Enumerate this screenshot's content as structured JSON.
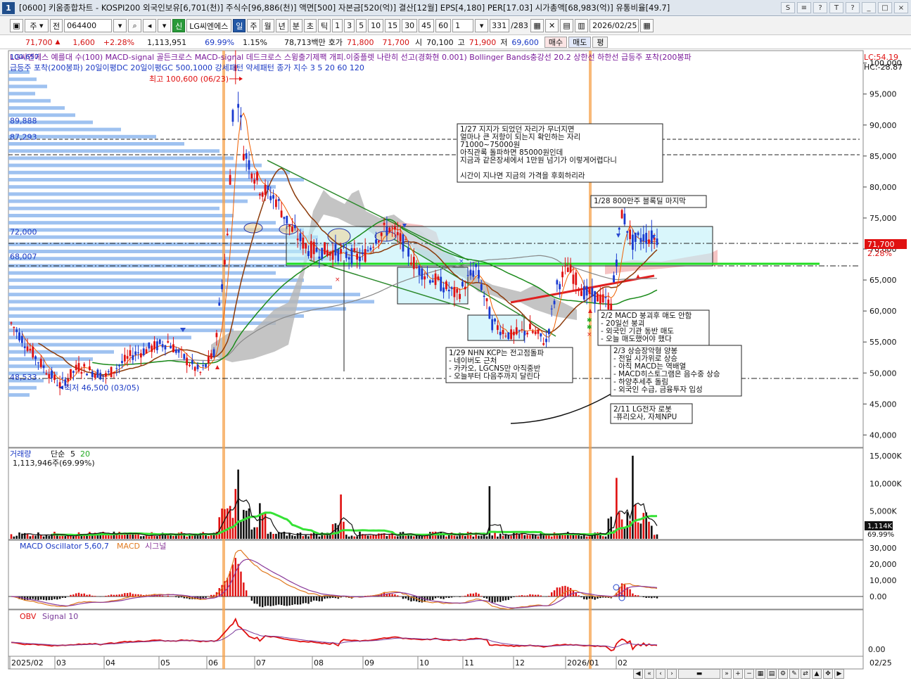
{
  "window": {
    "screen_no": "1",
    "title": "[0600] 키움종합차트 - KOSPI200 외국인보유[6,701(천)] 주식수[96,886(천)] 액면[500] 자본금[520(억)] 결산[12월] EPS[4,180] PER[17.03] 시가총액[68,983(억)] 유통비율[49.7]",
    "controls": [
      "S",
      "≡",
      "?",
      "T",
      "?",
      "_",
      "□",
      "×"
    ]
  },
  "toolbar": {
    "market_select": "주",
    "prev_label": "전",
    "code": "064400",
    "stock_name": "LG씨엔에스",
    "badge_sin": "신",
    "periods": [
      "일",
      "주",
      "월",
      "년",
      "분",
      "초",
      "틱"
    ],
    "active_period": "일",
    "intervals": [
      "1",
      "3",
      "5",
      "10",
      "15",
      "30",
      "45",
      "60"
    ],
    "interval_input": "1",
    "count": "331",
    "count_total": "/283",
    "date": "2026/02/25"
  },
  "quote": {
    "price": "71,700",
    "change_arrow": "▲",
    "change": "1,600",
    "change_pct": "+2.28%",
    "volume": "1,113,951",
    "volume_ratio": "69.99%",
    "turnover": "1.15%",
    "amount": "78,713백만",
    "hoga_label": "호가",
    "hoga": "71,800",
    "hoga2": "71,700",
    "open_label": "시",
    "open": "70,100",
    "high_label": "고",
    "high": "71,900",
    "low_label": "저",
    "low": "69,600",
    "buy": "매수",
    "sell": "매도",
    "avg": "평"
  },
  "price_panel": {
    "legend_row1": "LG씨엔에스 예를대 수(100) MACD-signal 골든크로스 MACD-signal 데드크로스 스윙출기제팩 개피.이중플렛 나란히 선고(경화현 0.001) Bollinger Bands충강선 20.2 상한선 하한선 급등주 포착(200봉파",
    "legend_row2": "급등주 포착(200봉파) 20일이평DC 20일이평GC 500,1000 강세패턴 약세패턴 종가 지수 3 5 20 60 120",
    "top_left_value": "100,657",
    "lc_label": "LC:54.19",
    "hc_label": "HC:-28.87",
    "high_marker": "최고 100,600 (06/23)",
    "low_marker": "최저 46,500 (03/05)",
    "left_levels": [
      "89,888",
      "87,293",
      "72,000",
      "68,007",
      "48,533"
    ],
    "y_ticks": [
      "100,000",
      "95,000",
      "90,000",
      "85,000",
      "80,000",
      "75,000",
      "70,000",
      "65,000",
      "60,000",
      "55,000",
      "50,000",
      "45,000",
      "40,000"
    ],
    "y_range": [
      38000,
      102000
    ],
    "current_price_tag": "71,700",
    "current_pct_tag": "2.28%",
    "annotations": {
      "jan27": [
        "1/27 지지가 되었던 자리가 무너지면",
        "얼마나 큰 저항이 되는지 확인하는 자리",
        "71000~75000원",
        "아직관록 돌파하면 85000원인데",
        "지금과 같은장세에서 1만원 넘기가 이렇게어렵다니",
        "",
        "시간이 지나면 지금의 가격을 후회하리라"
      ],
      "jan28": [
        "1/28 800만주 블록딜 마지막"
      ],
      "jan29": [
        "1/29 NHN KCP는 전고점돌파",
        "- 네이버도 근처",
        "- 카카오, LGCNS만 아직중반",
        "- 오늘부터 다음주까지 달린다"
      ],
      "feb2": [
        "2/2 MACD 붕괴후 매도 안함",
        "- 20일선 붕괴",
        "- 외국인 기관 동반 매도",
        "- 오늘 매도했어야 했다"
      ],
      "feb3": [
        "2/3 상승장악형 양봉",
        "- 전일 시가위로 상승",
        "- 아직 MACD는 역배열",
        "- MACD히스토그램은 음수중 상승",
        "- 하양추세추 돌림",
        "- 외국인 수급, 금융투자 입성"
      ],
      "feb11": [
        "2/11 LG전자 로봇",
        "-퓨리오사, 자체NPU"
      ]
    }
  },
  "volume_panel": {
    "legend": [
      "거래량",
      "단순",
      "5",
      "20"
    ],
    "value_label": "1,113,946주(69.99%)",
    "y_ticks": [
      "15,000K",
      "10,000K",
      "5,000K"
    ],
    "current_tag": "1,114K",
    "pct_tag": "69.99%"
  },
  "macd_panel": {
    "legend": [
      "MACD Oscillator 5,60,7",
      "MACD",
      "시그널"
    ],
    "y_ticks": [
      "30,000",
      "20,000",
      "10,000",
      "0.00"
    ]
  },
  "obv_panel": {
    "legend": [
      "OBV",
      "Signal 10"
    ],
    "y_ticks": [
      "0.00"
    ]
  },
  "x_axis": {
    "labels": [
      "2025/02",
      "03",
      "04",
      "05",
      "06",
      "07",
      "08",
      "09",
      "10",
      "11",
      "12",
      "2026/01",
      "02"
    ],
    "right_label": "02/25"
  },
  "colors": {
    "up": "#e01010",
    "down": "#1a3ad0",
    "ma_green": "#1aa81a",
    "ma_brown": "#8b3a0a",
    "box_fill": "#bff0f8",
    "highlight": "#f0a050",
    "volume_ma": "#36e236"
  }
}
